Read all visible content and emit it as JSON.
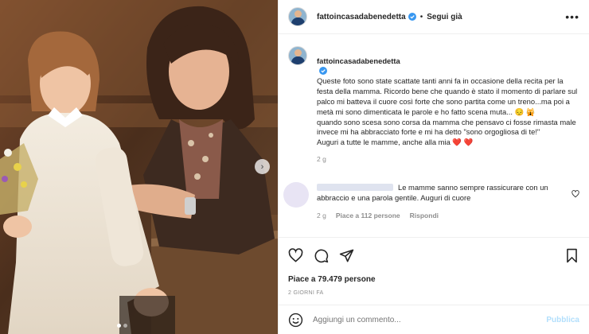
{
  "post": {
    "username": "fattoincasadabenedetta",
    "follow_label": "Segui già",
    "more_icon": "more-options-icon",
    "media": {
      "next_icon": "chevron-right-icon",
      "dots_count": 2,
      "active_dot": 1
    }
  },
  "caption": {
    "username": "fattoincasadabenedetta",
    "lines": [
      "Queste foto sono state scattate tanti anni fa in occasione della recita per la festa della mamma. Ricordo bene che quando è stato il momento di parlare sul palco mi batteva il cuore così forte che sono partita come un treno...ma poi a metà mi sono dimenticata le parole e ho fatto scena muta... 😔 🙀",
      "quando sono scesa sono corsa da mamma che pensavo ci fosse rimasta male invece mi ha abbracciato forte e mi ha detto \"sono orgogliosa di te!\"",
      "Auguri a tutte le mamme, anche alla mia ❤️ ❤️"
    ],
    "time": "2 g"
  },
  "comment": {
    "text": "Le mamme sanno sempre rassicurare con un abbraccio e una parola gentile. Auguri di cuore",
    "time": "2 g",
    "likes": "Piace a 112 persone",
    "reply": "Rispondi"
  },
  "actions": {
    "likes": "Piace a 79.479 persone",
    "date": "2 GIORNI FA"
  },
  "add_comment": {
    "placeholder": "Aggiungi un commento...",
    "publish": "Pubblica"
  },
  "colors": {
    "verified": "#3897f0",
    "publish": "#b2dffc",
    "secondary_text": "#8e8e8e"
  }
}
